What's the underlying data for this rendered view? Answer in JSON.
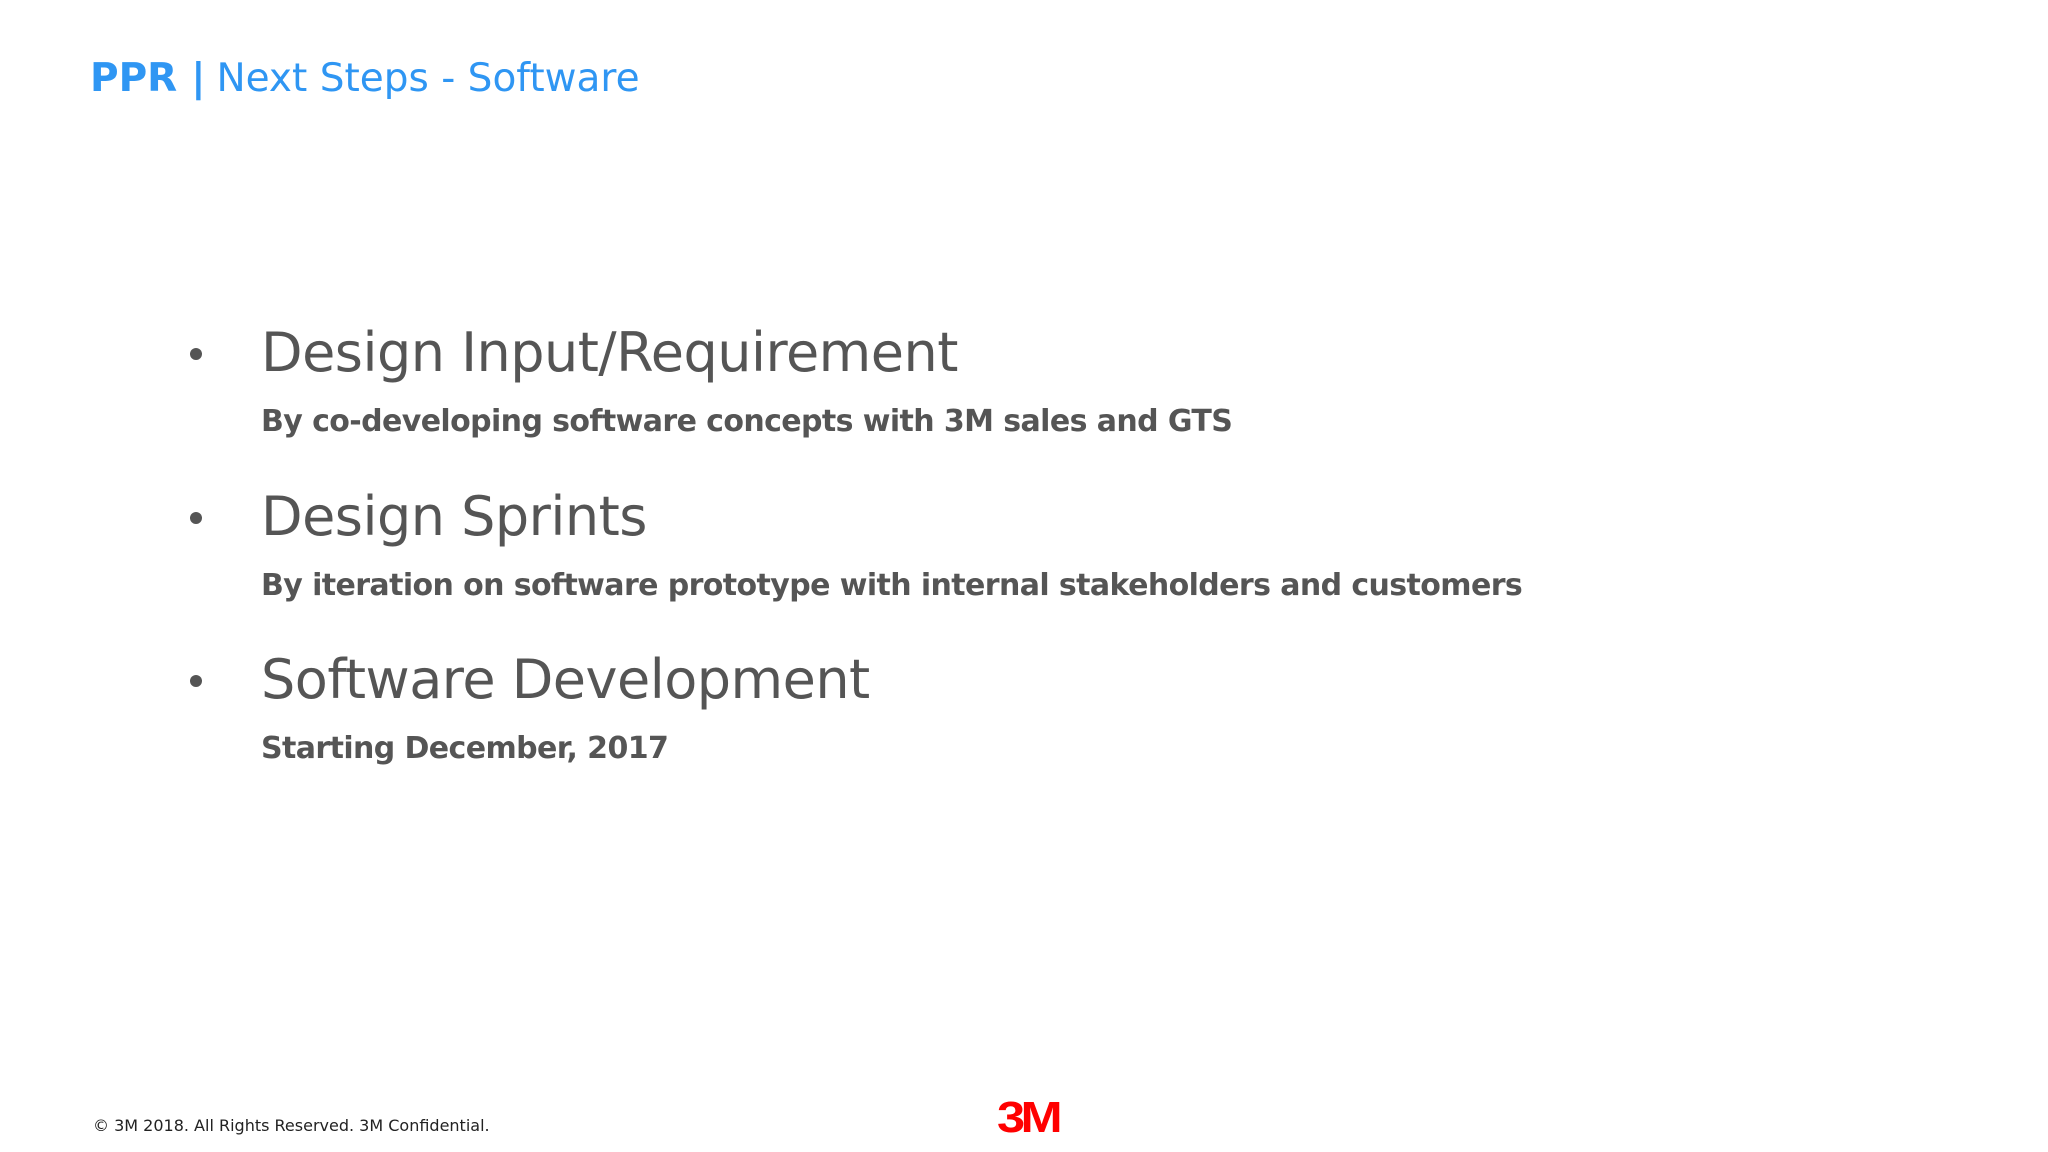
{
  "header": {
    "title_bold": "PPR",
    "separator": "|",
    "title_rest": "Next Steps - Software"
  },
  "bullets": [
    {
      "heading": "Design Input/Requirement",
      "sub": "By co-developing software concepts with 3M sales and GTS"
    },
    {
      "heading": "Design Sprints",
      "sub": "By iteration on software prototype with internal stakeholders and customers"
    },
    {
      "heading": "Software Development",
      "sub": "Starting December, 2017"
    }
  ],
  "footer": {
    "copyright": "© 3M  2018. All Rights Reserved.  3M Confidential.",
    "logo_text": "3M"
  },
  "colors": {
    "accent": "#2f96f3",
    "text": "#555555",
    "logo": "#ff0000"
  }
}
